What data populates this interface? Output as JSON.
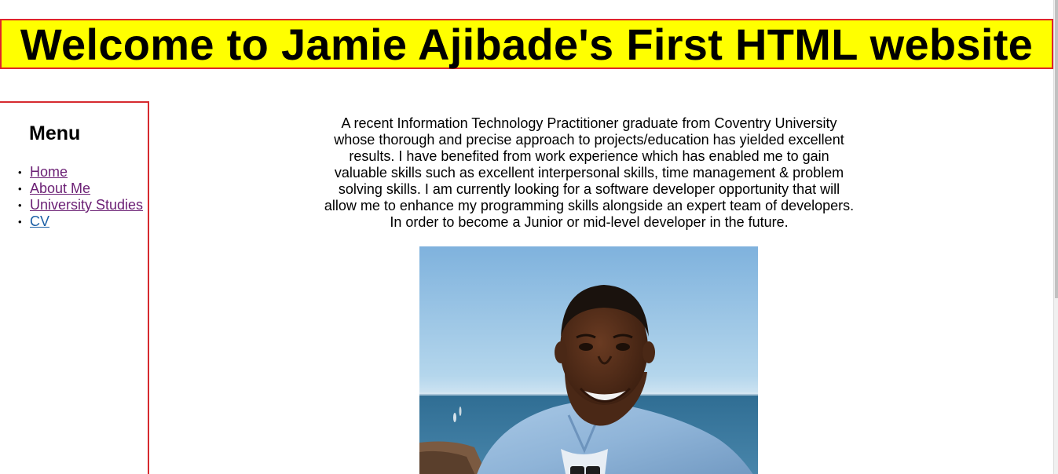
{
  "header": {
    "title": "Welcome to Jamie Ajibade's First HTML website"
  },
  "sidebar": {
    "heading": "Menu",
    "items": [
      {
        "label": "Home",
        "visited": true
      },
      {
        "label": "About Me",
        "visited": true
      },
      {
        "label": "University Studies",
        "visited": true
      },
      {
        "label": "CV",
        "visited": false
      }
    ]
  },
  "main": {
    "intro": "A recent Information Technology Practitioner graduate from Coventry University whose thorough and precise approach to projects/education has yielded excellent results. I have benefited from work experience which has enabled me to gain valuable skills such as excellent interpersonal skills, time management & problem solving skills. I am currently looking for a software developer opportunity that will allow me to enhance my programming skills alongside an expert team of developers. In order to become a Junior or mid-level developer in the future."
  },
  "colors": {
    "header_bg": "#ffff00",
    "border": "#e0242a",
    "link_visited": "#6b1f74",
    "link": "#1b5fa6"
  }
}
